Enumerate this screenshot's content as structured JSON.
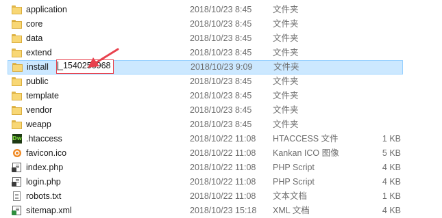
{
  "colors": {
    "selection_bg": "#cce8ff",
    "selection_border": "#99d1ff",
    "annotation_red": "#e8414d",
    "folder_yellow": "#f8d775",
    "meta_text": "#6d6d6d"
  },
  "files": [
    {
      "name": "application",
      "date": "2018/10/23 8:45",
      "type": "文件夹",
      "size": "",
      "icon": "folder-icon"
    },
    {
      "name": "core",
      "date": "2018/10/23 8:45",
      "type": "文件夹",
      "size": "",
      "icon": "folder-icon"
    },
    {
      "name": "data",
      "date": "2018/10/23 8:45",
      "type": "文件夹",
      "size": "",
      "icon": "folder-icon"
    },
    {
      "name": "extend",
      "date": "2018/10/23 8:45",
      "type": "文件夹",
      "size": "",
      "icon": "folder-icon"
    },
    {
      "name_prefix": "install",
      "name_rename": "_1540256968",
      "date": "2018/10/23 9:09",
      "type": "文件夹",
      "size": "",
      "icon": "folder-icon",
      "selected": true
    },
    {
      "name": "public",
      "date": "2018/10/23 8:45",
      "type": "文件夹",
      "size": "",
      "icon": "folder-icon"
    },
    {
      "name": "template",
      "date": "2018/10/23 8:45",
      "type": "文件夹",
      "size": "",
      "icon": "folder-icon"
    },
    {
      "name": "vendor",
      "date": "2018/10/23 8:45",
      "type": "文件夹",
      "size": "",
      "icon": "folder-icon"
    },
    {
      "name": "weapp",
      "date": "2018/10/23 8:45",
      "type": "文件夹",
      "size": "",
      "icon": "folder-icon"
    },
    {
      "name": ".htaccess",
      "date": "2018/10/22 11:08",
      "type": "HTACCESS 文件",
      "size": "1 KB",
      "icon": "dreamweaver-icon",
      "icon_text": "Dw"
    },
    {
      "name": "favicon.ico",
      "date": "2018/10/22 11:08",
      "type": "Kankan ICO 图像",
      "size": "5 KB",
      "icon": "kankan-ico-icon"
    },
    {
      "name": "index.php",
      "date": "2018/10/22 11:08",
      "type": "PHP Script",
      "size": "4 KB",
      "icon": "php-file-icon"
    },
    {
      "name": "login.php",
      "date": "2018/10/22 11:08",
      "type": "PHP Script",
      "size": "4 KB",
      "icon": "php-file-icon"
    },
    {
      "name": "robots.txt",
      "date": "2018/10/22 11:08",
      "type": "文本文档",
      "size": "1 KB",
      "icon": "text-file-icon"
    },
    {
      "name": "sitemap.xml",
      "date": "2018/10/23 15:18",
      "type": "XML 文档",
      "size": "4 KB",
      "icon": "xml-file-icon"
    }
  ]
}
